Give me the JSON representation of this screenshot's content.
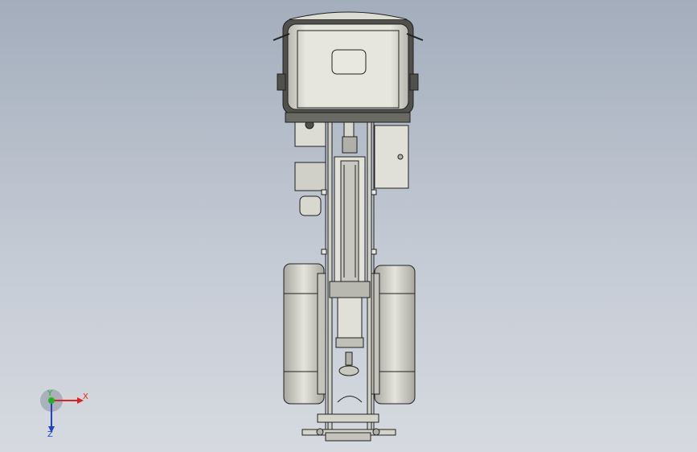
{
  "viewport": {
    "background_top": "#a3adbc",
    "background_bottom": "#d6dae0"
  },
  "model": {
    "body_fill": "#dcdcd4",
    "shade_fill": "#b4b4ac",
    "dark_fill": "#50504c",
    "outline": "#202020"
  },
  "triad": {
    "x_label": "X",
    "y_label": "Y",
    "z_label": "Z",
    "x_color": "#e02020",
    "y_color": "#20b020",
    "z_color": "#2040d0"
  }
}
